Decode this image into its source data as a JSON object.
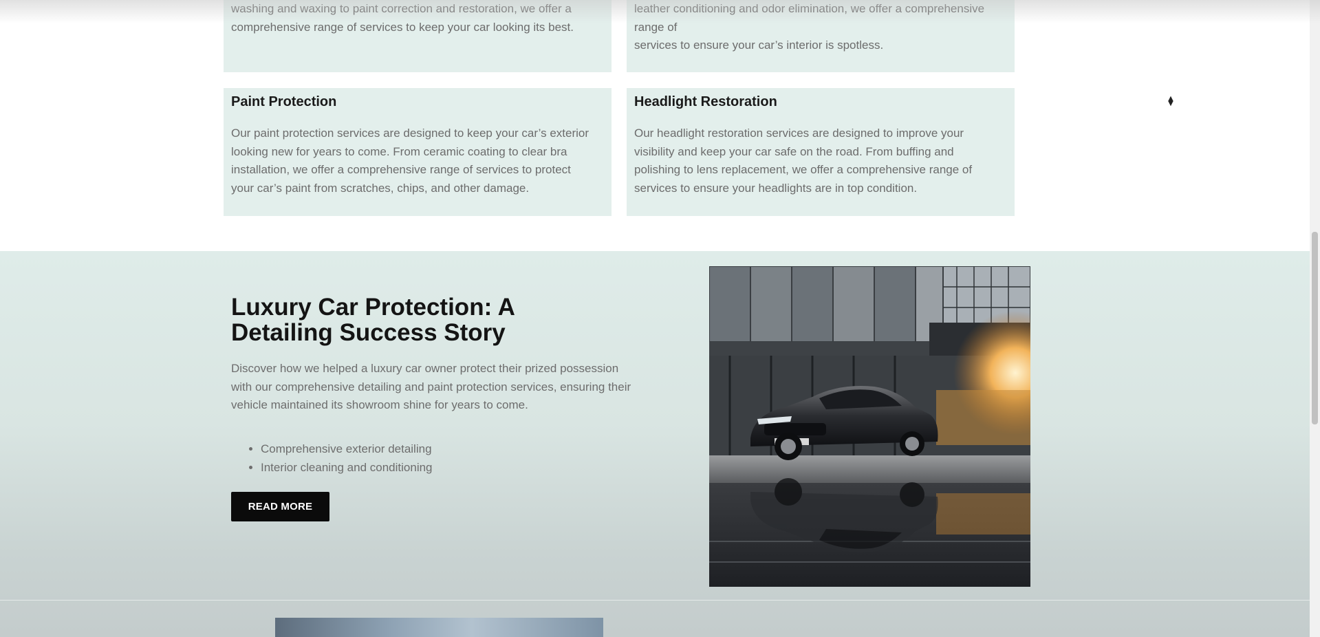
{
  "services": [
    {
      "title": "",
      "text_lines": [
        "washing and waxing to paint correction and restoration, we offer a",
        "comprehensive range of services to keep your car looking its best."
      ]
    },
    {
      "title": "",
      "text_lines": [
        "leather conditioning and odor elimination, we offer a comprehensive",
        "range of",
        "services to ensure your car’s interior is spotless."
      ]
    },
    {
      "title": "Paint Protection",
      "text_lines": [
        "Our paint protection services are designed to keep your car’s exterior",
        "looking new for years to come. From ceramic coating to clear bra",
        "installation, we offer a comprehensive range of services to protect",
        "your car’s paint from scratches, chips, and other damage."
      ]
    },
    {
      "title": "Headlight Restoration",
      "text_lines": [
        "Our headlight restoration services are designed to improve your",
        "visibility and keep your car safe on the road. From buffing and",
        "polishing to lens replacement, we offer a comprehensive range of",
        "services to ensure your headlights are in top condition."
      ]
    }
  ],
  "story": {
    "title_lines": [
      "Luxury Car Protection: A",
      "Detailing Success Story"
    ],
    "description_lines": [
      "Discover how we helped a luxury car owner protect their prized possession",
      "with our comprehensive detailing and paint protection services, ensuring their",
      "vehicle maintained its showroom shine for years to come."
    ],
    "bullets": [
      "Comprehensive exterior detailing",
      "Interior cleaning and conditioning"
    ],
    "button_label": "READ MORE"
  },
  "icons": {
    "sort": "sort-arrows-icon"
  },
  "colors": {
    "card_bg": "#e3efec",
    "section_bg": "#dfece9",
    "button_bg": "#0b0b0b",
    "button_text": "#ffffff",
    "body_text": "#6d6d6d",
    "heading_text": "#141414"
  }
}
